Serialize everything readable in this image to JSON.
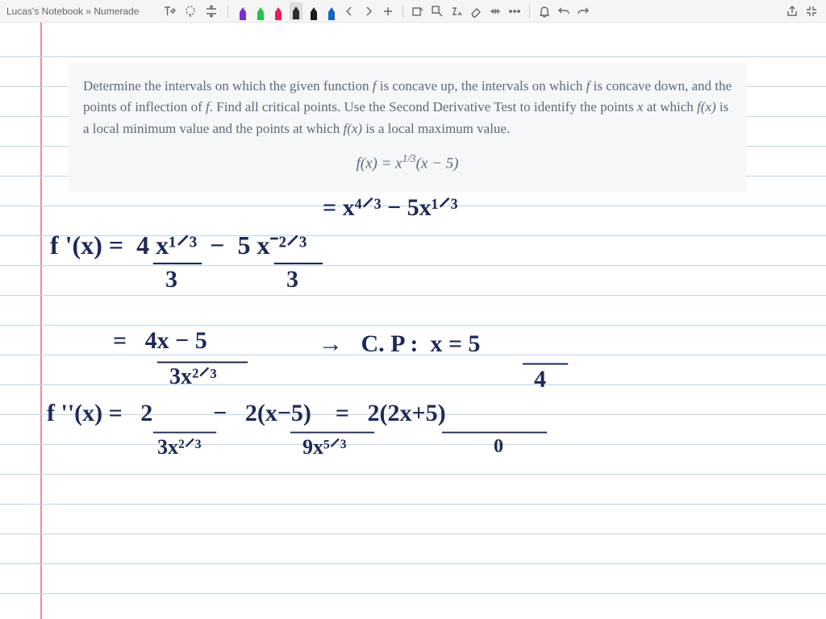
{
  "breadcrumb": "Lucas's Notebook » Numerade",
  "problem": {
    "text_parts": [
      "Determine the intervals on which the given function ",
      "f",
      " is concave up, the intervals on which ",
      "f",
      " is concave down, and the points of inflection of ",
      "f",
      ". Find all critical points. Use the Second Derivative Test to identify the points ",
      "x",
      " at which ",
      "f(x)",
      " is a local minimum value and the points at which ",
      "f(x)",
      " is a local maximum value."
    ],
    "equation": "f(x) = x^{1/3}(x − 5)"
  },
  "handwriting": {
    "line0": "= x⁴⸍³ − 5x¹⸍³",
    "line1": "f '(x) =  4 x¹⸍³  −  5 x⁻²⸍³",
    "line1_den1": "3",
    "line1_den2": "3",
    "line2a": "=   4x − 5",
    "line2a_den": "3x²⸍³",
    "line2_arrow": "→   C. P :  x = 5",
    "line2_cp_den": "4",
    "line3": "f ''(x) =   2          −   2(x−5)    =   2(2x+5)",
    "line3_den1": "3x²⸍³",
    "line3_den2": "9x⁵⸍³",
    "line3_den3": "0"
  },
  "pens": [
    {
      "color": "#7830c9"
    },
    {
      "color": "#27c24c"
    },
    {
      "color": "#e91e63"
    },
    {
      "color": "#2d2d2d",
      "selected": true
    },
    {
      "color": "#1e1e1e"
    },
    {
      "color": "#1565c0"
    }
  ]
}
